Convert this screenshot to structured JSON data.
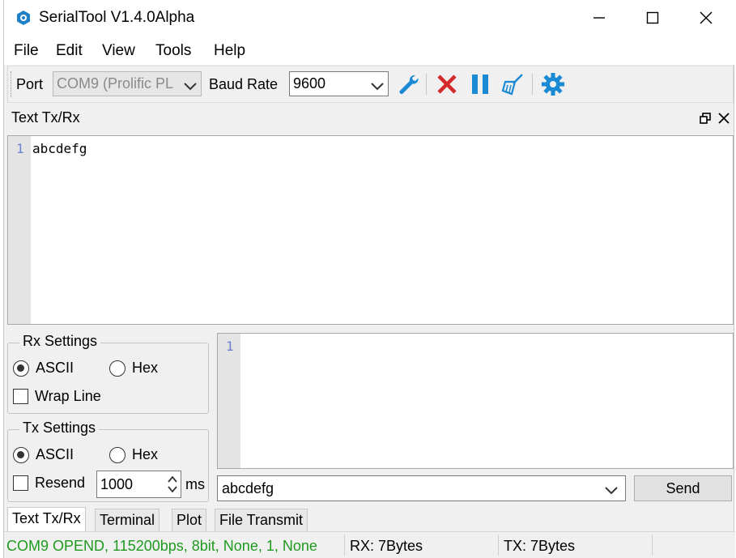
{
  "window": {
    "title": "SerialTool V1.4.0Alpha",
    "controls": [
      "minimize",
      "maximize",
      "close"
    ]
  },
  "menu": [
    "File",
    "Edit",
    "View",
    "Tools",
    "Help"
  ],
  "toolbar": {
    "port_label": "Port",
    "port_value": "COM9 (Prolific PL",
    "baud_label": "Baud Rate",
    "baud_value": "9600",
    "buttons": [
      "wrench-icon",
      "close-port-icon",
      "pause-icon",
      "clear-icon",
      "settings-icon"
    ],
    "colors": {
      "icon_blue": "#1a8ad4",
      "close_red": "#d62b2b"
    }
  },
  "panel": {
    "title": "Text Tx/Rx",
    "rx_editor": {
      "line_number": "1",
      "text": "abcdefg"
    },
    "tx_editor": {
      "line_number": "1",
      "text": ""
    }
  },
  "rx_settings": {
    "title": "Rx Settings",
    "ascii_label": "ASCII",
    "hex_label": "Hex",
    "selected": "ASCII",
    "wrap_label": "Wrap Line",
    "wrap_checked": false
  },
  "tx_settings": {
    "title": "Tx Settings",
    "ascii_label": "ASCII",
    "hex_label": "Hex",
    "selected": "ASCII",
    "resend_label": "Resend",
    "resend_checked": false,
    "interval_value": "1000",
    "interval_unit": "ms"
  },
  "send": {
    "input_value": "abcdefg",
    "button_label": "Send"
  },
  "tabs": [
    "Text Tx/Rx",
    "Terminal",
    "Plot",
    "File Transmit"
  ],
  "status": {
    "connection": "COM9 OPEND, 115200bps, 8bit, None, 1, None",
    "rx": "RX: 7Bytes",
    "tx": "TX: 7Bytes",
    "connection_color": "#1e9a1e"
  }
}
